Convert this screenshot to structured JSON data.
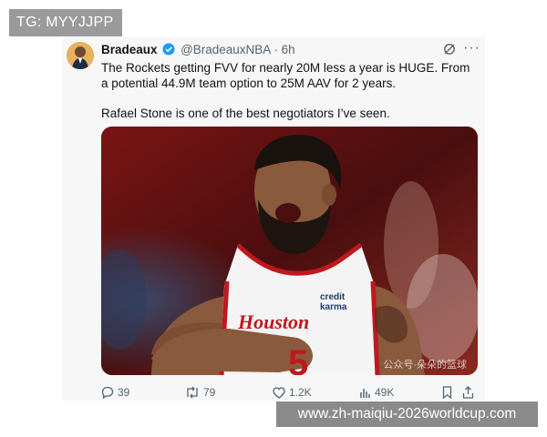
{
  "overlay": {
    "tg_label": "TG: MYYJJPP",
    "site_label": "www.zh-maiqiu-2026worldcup.com"
  },
  "tweet": {
    "display_name": "Bradeaux",
    "handle": "@BradeauxNBA",
    "dot": "·",
    "time": "6h",
    "text_line1": "The Rockets getting FVV for nearly 20M less a year is HUGE. From a potential 44.9M team option to 25M AAV for 2 years.",
    "text_line2": "Rafael Stone is one of the best negotiators I’ve seen.",
    "more_glyph": "···",
    "media": {
      "jersey_text": "credit karma",
      "jersey_word1": "credit",
      "jersey_word2": "karma",
      "jersey_script": "Houston",
      "jersey_number": "5",
      "watermark": "公众号·朵朵的篮球"
    },
    "stats": {
      "replies": "39",
      "reposts": "79",
      "likes": "1.2K",
      "views": "49K"
    },
    "icons": [
      "verified-badge-icon",
      "grok-icon",
      "more-icon",
      "reply-icon",
      "repost-icon",
      "like-icon",
      "views-icon",
      "bookmark-icon",
      "share-icon"
    ],
    "colors": {
      "verified": "#1d9bf0",
      "text": "#0f1419",
      "muted": "#536471"
    }
  }
}
